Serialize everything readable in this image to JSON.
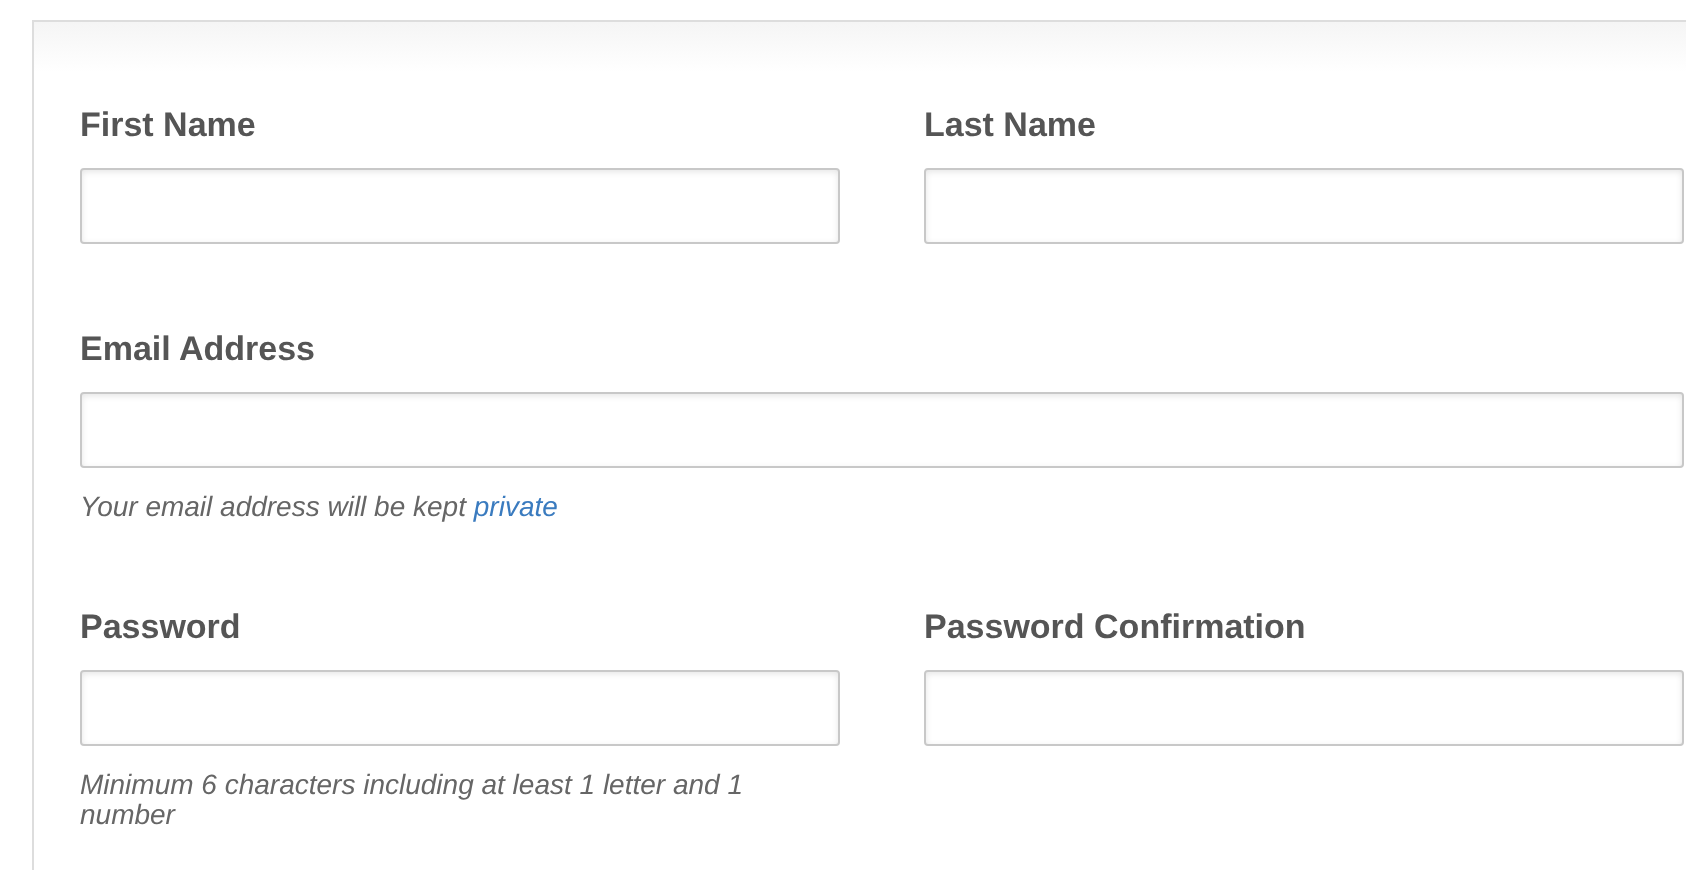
{
  "rows": [
    {
      "fields": [
        {
          "label": "First Name",
          "kind": "half"
        },
        {
          "label": "Last Name",
          "kind": "half"
        }
      ]
    },
    {
      "fields": [
        {
          "label": "Email Address",
          "kind": "wide",
          "help": {
            "text": "Your email address will be kept",
            "link": "private"
          }
        }
      ]
    },
    {
      "fields": [
        {
          "label": "Password",
          "kind": "half",
          "help": {
            "text": "Minimum 6 characters including at least 1 letter and 1 number"
          }
        },
        {
          "label": "Password Confirmation",
          "kind": "half"
        }
      ]
    }
  ]
}
